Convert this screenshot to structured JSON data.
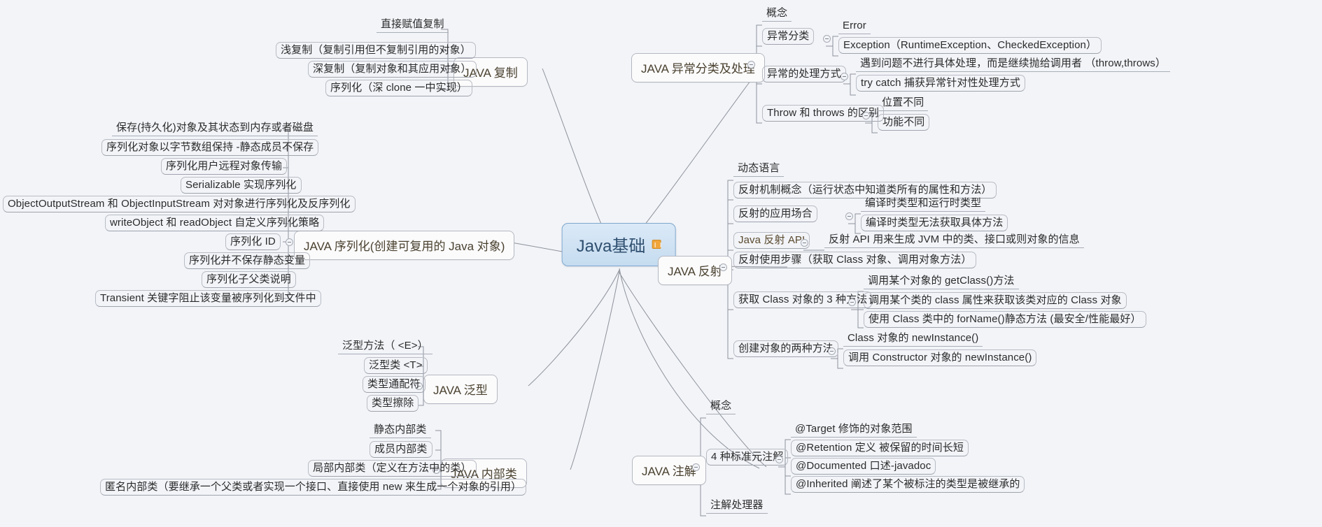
{
  "central": {
    "label": "Java基础",
    "badge_icon": "map-badge-icon"
  },
  "branches": [
    {
      "id": "copy",
      "title": "JAVA 复制",
      "children": [
        {
          "label": "直接赋值复制",
          "style": "underline"
        },
        {
          "label": "浅复制（复制引用但不复制引用的对象）",
          "style": "boxed"
        },
        {
          "label": "深复制（复制对象和其应用对象）",
          "style": "boxed"
        },
        {
          "label": "序列化（深 clone 一中实现）",
          "style": "boxed"
        }
      ]
    },
    {
      "id": "serialization",
      "title": "JAVA 序列化(创建可复用的 Java 对象)",
      "children": [
        {
          "label": "保存(持久化)对象及其状态到内存或者磁盘",
          "style": "underline"
        },
        {
          "label": "序列化对象以字节数组保持 -静态成员不保存",
          "style": "boxed"
        },
        {
          "label": "序列化用户远程对象传输",
          "style": "boxed"
        },
        {
          "label": "Serializable 实现序列化",
          "style": "boxed"
        },
        {
          "label": "ObjectOutputStream 和 ObjectInputStream 对对象进行序列化及反序列化",
          "style": "boxed"
        },
        {
          "label": "writeObject 和 readObject 自定义序列化策略",
          "style": "boxed"
        },
        {
          "label": "序列化 ID",
          "style": "boxed"
        },
        {
          "label": "序列化并不保存静态变量",
          "style": "boxed"
        },
        {
          "label": "序列化子父类说明",
          "style": "boxed"
        },
        {
          "label": "Transient 关键字阻止该变量被序列化到文件中",
          "style": "boxed"
        }
      ]
    },
    {
      "id": "generics",
      "title": "JAVA 泛型",
      "children": [
        {
          "label": "泛型方法（ <E>）",
          "style": "underline"
        },
        {
          "label": "泛型类 <T>",
          "style": "boxed"
        },
        {
          "label": "类型通配符",
          "style": "boxed"
        },
        {
          "label": "类型擦除",
          "style": "boxed"
        }
      ]
    },
    {
      "id": "innerclass",
      "title": "JAVA 内部类",
      "children": [
        {
          "label": "静态内部类",
          "style": "underline"
        },
        {
          "label": "成员内部类",
          "style": "boxed"
        },
        {
          "label": "局部内部类（定义在方法中的类）",
          "style": "boxed"
        },
        {
          "label": "匿名内部类（要继承一个父类或者实现一个接口、直接使用 new 来生成一个对象的引用）",
          "style": "boxed"
        }
      ]
    },
    {
      "id": "exception",
      "title": "JAVA 异常分类及处理",
      "children": [
        {
          "label": "概念",
          "style": "underline"
        },
        {
          "label": "异常分类",
          "style": "boxed",
          "has_handle": true,
          "grandchildren": [
            {
              "label": "Error",
              "style": "underline"
            },
            {
              "label": "Exception（RuntimeException、CheckedException）",
              "style": "boxed"
            }
          ]
        },
        {
          "label": "异常的处理方式",
          "style": "boxed",
          "has_handle": true,
          "grandchildren": [
            {
              "label": "遇到问题不进行具体处理，而是继续抛给调用者 （throw,throws）",
              "style": "underline"
            },
            {
              "label": "try catch 捕获异常针对性处理方式",
              "style": "boxed"
            }
          ]
        },
        {
          "label": "Throw 和 throws 的区别",
          "style": "boxed",
          "has_handle": true,
          "grandchildren": [
            {
              "label": "位置不同",
              "style": "underline"
            },
            {
              "label": "功能不同",
              "style": "boxed"
            }
          ]
        }
      ]
    },
    {
      "id": "reflection",
      "title": "JAVA 反射",
      "children": [
        {
          "label": "动态语言",
          "style": "underline"
        },
        {
          "label": "反射机制概念（运行状态中知道类所有的属性和方法）",
          "style": "boxed"
        },
        {
          "label": "反射的应用场合",
          "style": "boxed",
          "has_handle": true,
          "grandchildren": [
            {
              "label": "编译时类型和运行时类型",
              "style": "underline"
            },
            {
              "label": "编译时类型无法获取具体方法",
              "style": "boxed"
            }
          ]
        },
        {
          "label": "Java 反射 API",
          "style": "boxed",
          "has_handle": true,
          "grandchildren": [
            {
              "label": "反射 API 用来生成 JVM 中的类、接口或则对象的信息",
              "style": "underline"
            }
          ]
        },
        {
          "label": "反射使用步骤（获取 Class 对象、调用对象方法）",
          "style": "boxed"
        },
        {
          "label": "获取 Class 对象的 3 种方法",
          "style": "boxed",
          "has_handle": true,
          "grandchildren": [
            {
              "label": "调用某个对象的 getClass()方法",
              "style": "underline"
            },
            {
              "label": "调用某个类的 class 属性来获取该类对应的 Class 对象",
              "style": "boxed"
            },
            {
              "label": "使用 Class 类中的 forName()静态方法 (最安全/性能最好）",
              "style": "boxed"
            }
          ]
        },
        {
          "label": "创建对象的两种方法",
          "style": "boxed",
          "has_handle": true,
          "grandchildren": [
            {
              "label": "Class 对象的 newInstance()",
              "style": "underline"
            },
            {
              "label": "调用 Constructor 对象的 newInstance()",
              "style": "boxed"
            }
          ]
        }
      ]
    },
    {
      "id": "annotation",
      "title": "JAVA 注解",
      "children": [
        {
          "label": "概念",
          "style": "underline"
        },
        {
          "label": "4 种标准元注解",
          "style": "boxed",
          "has_handle": true,
          "grandchildren": [
            {
              "label": "@Target 修饰的对象范围",
              "style": "underline"
            },
            {
              "label": "@Retention 定义 被保留的时间长短",
              "style": "boxed"
            },
            {
              "label": "@Documented 口述-javadoc",
              "style": "boxed"
            },
            {
              "label": "@Inherited 阐述了某个被标注的类型是被继承的",
              "style": "boxed"
            }
          ]
        },
        {
          "label": "注解处理器",
          "style": "boxed"
        }
      ]
    }
  ],
  "colors": {
    "background": "#f2f4f8",
    "central_fill": "#cfe0f2",
    "central_text": "#2f4f6f",
    "node_border": "#b4b8c0",
    "topic_text": "#4a412f",
    "leaf_text": "#2b2b2b",
    "wire": "#8e929b",
    "badge": "#f0a53a"
  }
}
